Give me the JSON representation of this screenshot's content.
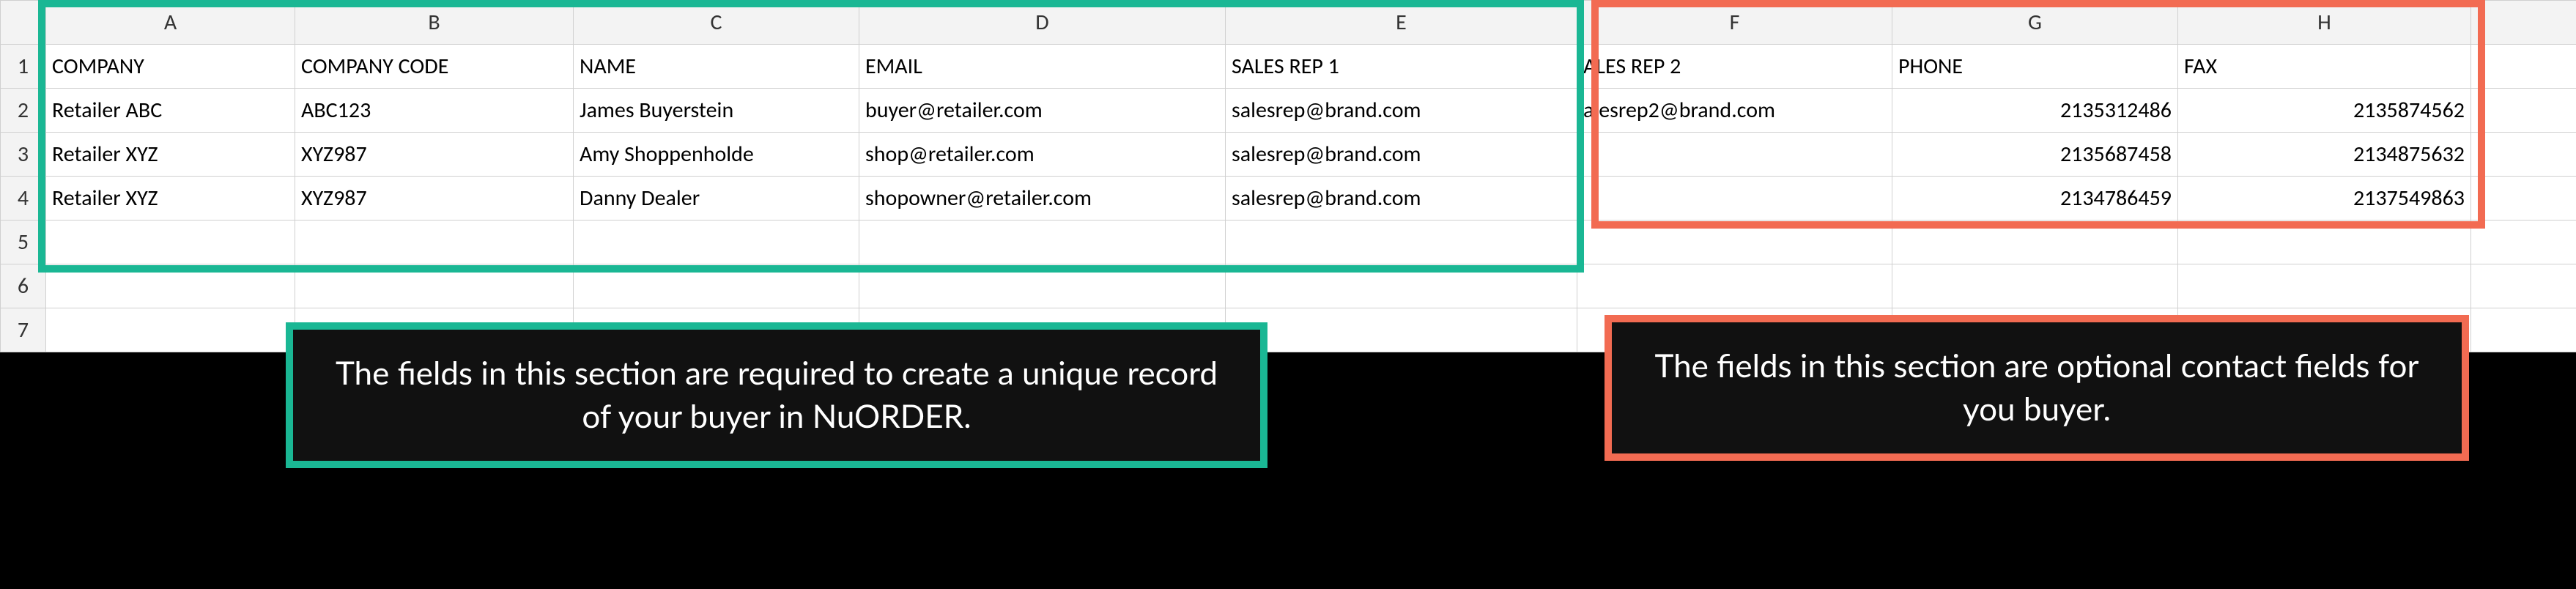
{
  "columns": [
    "A",
    "B",
    "C",
    "D",
    "E",
    "F",
    "G",
    "H"
  ],
  "rownums": [
    "1",
    "2",
    "3",
    "4",
    "5",
    "6",
    "7"
  ],
  "headers": {
    "A": "COMPANY",
    "B": "COMPANY CODE",
    "C": "NAME",
    "D": "EMAIL",
    "E": "SALES REP 1",
    "F": "ALES REP 2",
    "G": "PHONE",
    "H": "FAX"
  },
  "rows": [
    {
      "A": "Retailer ABC",
      "B": "ABC123",
      "C": "James Buyerstein",
      "D": "buyer@retailer.com",
      "E": "salesrep@brand.com",
      "F": "alesrep2@brand.com",
      "G": "2135312486",
      "H": "2135874562"
    },
    {
      "A": "Retailer XYZ",
      "B": "XYZ987",
      "C": "Amy Shoppenholde",
      "D": "shop@retailer.com",
      "E": "salesrep@brand.com",
      "F": "",
      "G": "2135687458",
      "H": "2134875632"
    },
    {
      "A": "Retailer XYZ",
      "B": "XYZ987",
      "C": "Danny Dealer",
      "D": "shopowner@retailer.com",
      "E": "salesrep@brand.com",
      "F": "",
      "G": "2134786459",
      "H": "2137549863"
    }
  ],
  "callouts": {
    "green": "The fields in this section are required to create a unique record of your buyer in NuORDER.",
    "red": "The fields in this section are optional contact fields for you buyer."
  }
}
